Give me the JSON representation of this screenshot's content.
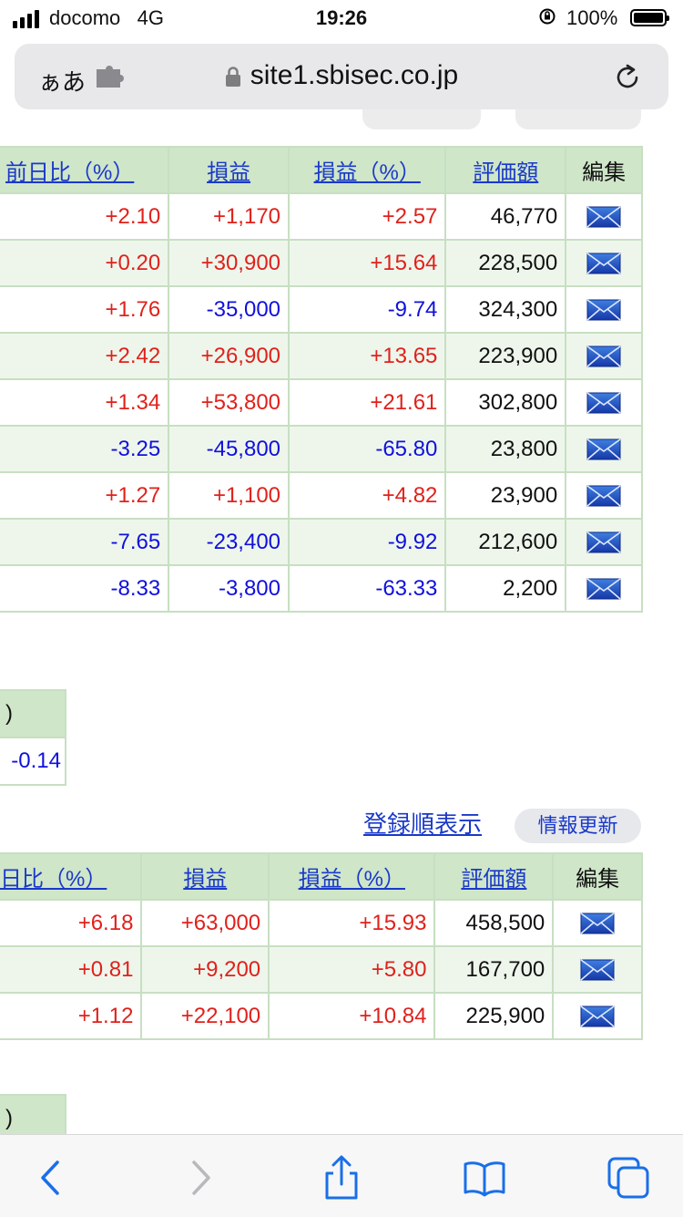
{
  "status_bar": {
    "carrier": "docomo",
    "network": "4G",
    "time": "19:26",
    "battery": "100%"
  },
  "browser": {
    "text_size_label": "ぁあ",
    "url": "site1.sbisec.co.jp"
  },
  "table1": {
    "headers": [
      "前日比（%）",
      "損益",
      "損益（%）",
      "評価額",
      "編集"
    ],
    "rows": [
      [
        "+2.10",
        "+1,170",
        "+2.57",
        "46,770"
      ],
      [
        "+0.20",
        "+30,900",
        "+15.64",
        "228,500"
      ],
      [
        "+1.76",
        "-35,000",
        "-9.74",
        "324,300"
      ],
      [
        "+2.42",
        "+26,900",
        "+13.65",
        "223,900"
      ],
      [
        "+1.34",
        "+53,800",
        "+21.61",
        "302,800"
      ],
      [
        "-3.25",
        "-45,800",
        "-65.80",
        "23,800"
      ],
      [
        "+1.27",
        "+1,100",
        "+4.82",
        "23,900"
      ],
      [
        "-7.65",
        "-23,400",
        "-9.92",
        "212,600"
      ],
      [
        "-8.33",
        "-3,800",
        "-63.33",
        "2,200"
      ]
    ]
  },
  "summary1": {
    "header": ")",
    "value": "-0.14"
  },
  "controls": {
    "order_link": "登録順表示",
    "refresh_button": "情報更新"
  },
  "table2": {
    "headers": [
      "日比（%）",
      "損益",
      "損益（%）",
      "評価額",
      "編集"
    ],
    "rows": [
      [
        "+6.18",
        "+63,000",
        "+15.93",
        "458,500"
      ],
      [
        "+0.81",
        "+9,200",
        "+5.80",
        "167,700"
      ],
      [
        "+1.12",
        "+22,100",
        "+10.84",
        "225,900"
      ]
    ]
  },
  "summary2": {
    "header": ")"
  },
  "colors": {
    "positive": "#e0211b",
    "negative": "#1010dd",
    "header_bg": "#cfe6c9",
    "link": "#1a39c9"
  },
  "icons": [
    "signal-icon",
    "orientation-lock-icon",
    "battery-icon",
    "extension-icon",
    "lock-icon",
    "reload-icon",
    "mail-envelope-icon",
    "back-icon",
    "forward-icon",
    "share-icon",
    "bookmarks-icon",
    "tabs-icon"
  ]
}
